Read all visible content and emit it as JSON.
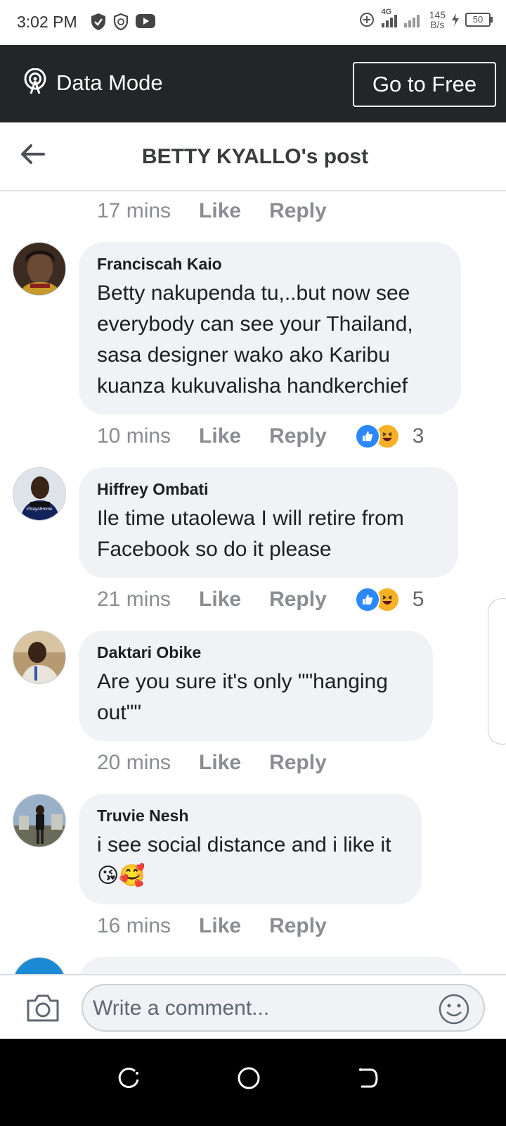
{
  "status_bar": {
    "time": "3:02 PM",
    "network": "4G",
    "speed_value": "145",
    "speed_unit": "B/s",
    "battery": "50"
  },
  "data_mode": {
    "label": "Data Mode",
    "button_label": "Go to Free"
  },
  "header": {
    "title": "BETTY KYALLO's post"
  },
  "top_meta": {
    "time": "17 mins",
    "like": "Like",
    "reply": "Reply"
  },
  "comments": [
    {
      "author": "Franciscah Kaio",
      "text": "Betty nakupenda tu,..but now see everybody can see your Thailand, sasa designer wako ako Karibu kuanza kukuvalisha handkerchief",
      "time": "10 mins",
      "like": "Like",
      "reply": "Reply",
      "reaction_count": "3"
    },
    {
      "author": "Hiffrey Ombati",
      "text": "Ile time utaolewa I will retire from Facebook so do it please",
      "time": "21 mins",
      "like": "Like",
      "reply": "Reply",
      "reaction_count": "5",
      "avatar_text": "#StayAtHome"
    },
    {
      "author": "Daktari Obike",
      "text": "Are you sure it's only \"\"hanging out\"\"",
      "time": "20 mins",
      "like": "Like",
      "reply": "Reply"
    },
    {
      "author": "Truvie Nesh",
      "text": "i see social distance and i like it😘🥰",
      "time": "16 mins",
      "like": "Like",
      "reply": "Reply"
    }
  ],
  "input": {
    "placeholder": "Write a comment..."
  },
  "colors": {
    "data_mode_bg": "#242526",
    "bubble_bg": "#f0f2f5",
    "like_blue": "#2d88ff",
    "haha_yellow": "#f7b125"
  }
}
